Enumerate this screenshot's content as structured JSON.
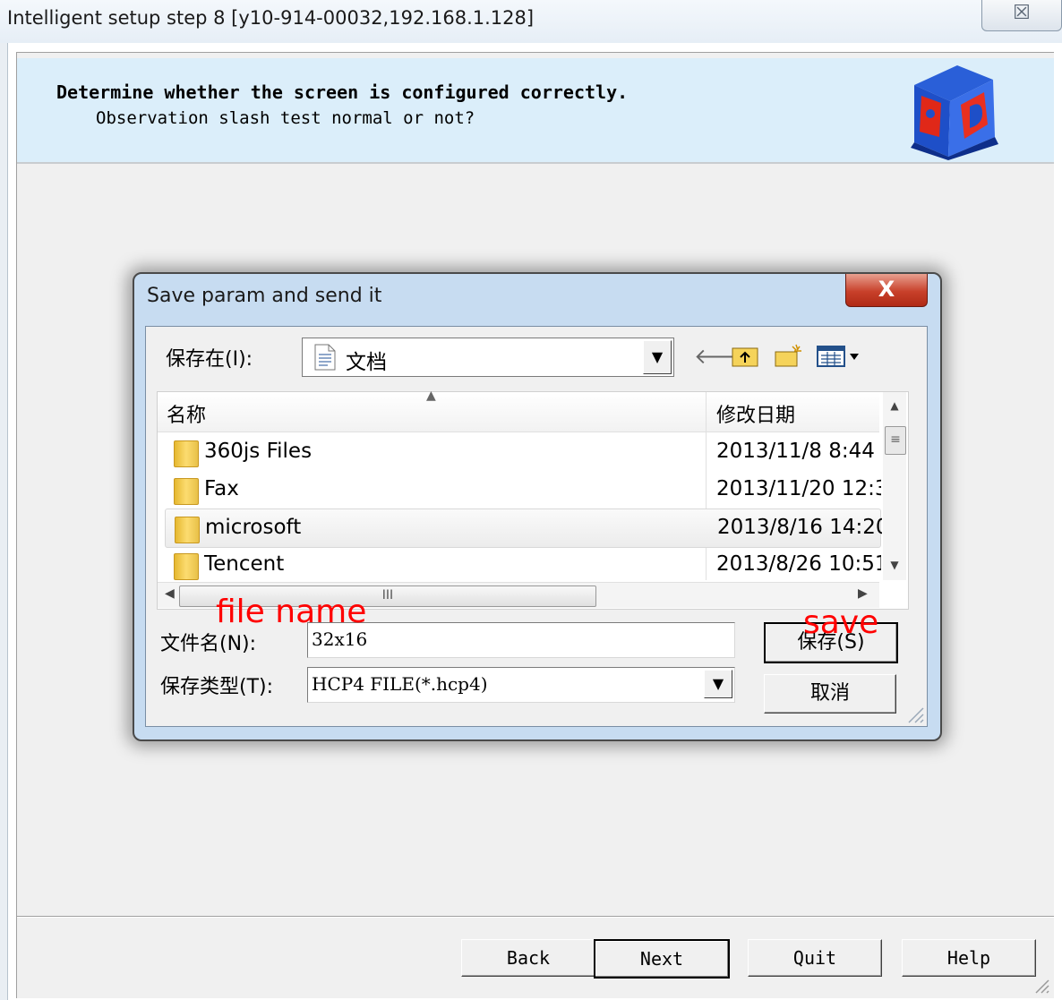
{
  "window": {
    "title": "Intelligent setup step 8 [y10-914-00032,192.168.1.128]",
    "close_glyph": "☒"
  },
  "header": {
    "title": "Determine whether the screen is configured correctly.",
    "subtitle": "Observation slash test normal or not?",
    "logo_icon": "cube-logo-icon"
  },
  "wizard_buttons": {
    "back": "Back",
    "next": "Next",
    "quit": "Quit",
    "help": "Help"
  },
  "dialog": {
    "title": "Save param and send it",
    "close_glyph": "X",
    "save_in_label": "保存在(I):",
    "save_in_value": "文档",
    "toolbar_icons": [
      "back-arrow-icon",
      "up-folder-icon",
      "new-folder-icon",
      "view-menu-icon"
    ],
    "columns": {
      "name": "名称",
      "date": "修改日期"
    },
    "files": [
      {
        "name": "360js Files",
        "date": "2013/11/8 8:44"
      },
      {
        "name": "Fax",
        "date": "2013/11/20 12:3"
      },
      {
        "name": "microsoft",
        "date": "2013/8/16 14:20"
      },
      {
        "name": "Tencent",
        "date": "2013/8/26 10:51"
      }
    ],
    "filename_label": "文件名(N):",
    "filename_value": "32x16",
    "filetype_label": "保存类型(T):",
    "filetype_value": "HCP4 FILE(*.hcp4)",
    "save_button": "保存(S)",
    "cancel_button": "取消"
  },
  "annotations": {
    "file_name": "file name",
    "save": "save",
    "color": "#ff0000"
  },
  "colors": {
    "header_band": "#dbeefa",
    "dialog_frame": "#c7dcf1",
    "close_red": "#c8402a"
  }
}
